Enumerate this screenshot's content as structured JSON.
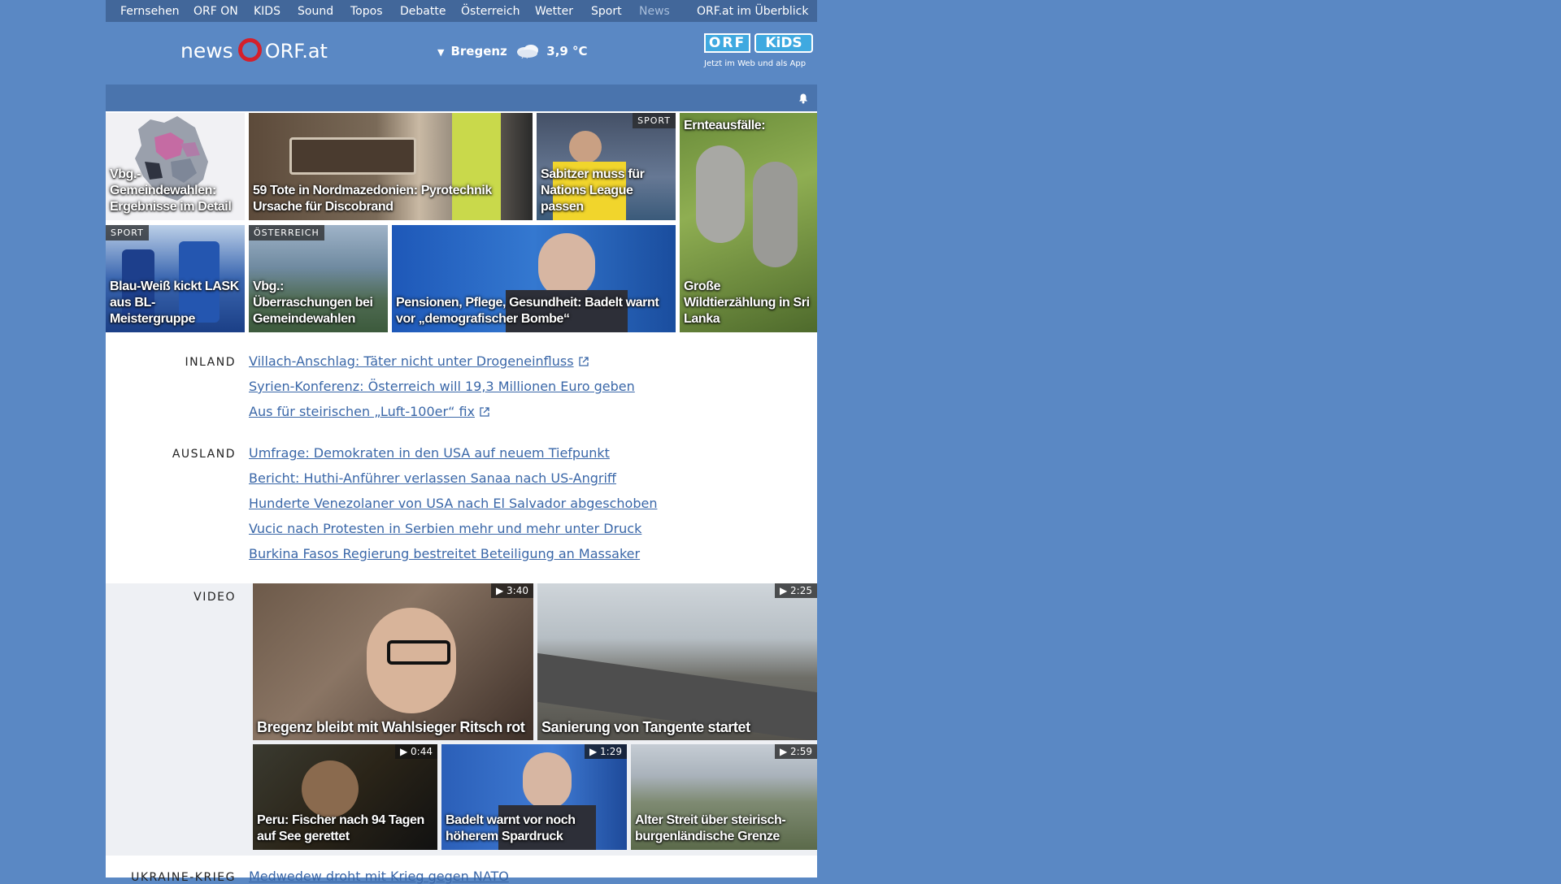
{
  "topnav": {
    "items": [
      "Fernsehen",
      "ORF ON",
      "KIDS",
      "Sound",
      "Topos",
      "Debatte",
      "Österreich",
      "Wetter",
      "Sport",
      "News",
      "ORF.at im Überblick"
    ],
    "current": "News"
  },
  "header": {
    "logo_prefix": "news",
    "logo_suffix": "ORF.at",
    "weather_location": "Bregenz",
    "weather_temp": "3,9 °C",
    "weather_icon": "cloud-rain-icon",
    "kids_orf": "ORF",
    "kids_label": "KiDS",
    "kids_tagline": "Jetzt im Web und als App"
  },
  "colors": {
    "background": "#5a88c4",
    "nav": "#42679a",
    "link": "#3a67a8",
    "orf_red": "#d4202c"
  },
  "tiles": [
    {
      "title": "Vbg.-Gemeindewahlen: Ergebnisse im Detail"
    },
    {
      "title": "59 Tote in Nordmazedonien: Pyrotechnik Ursache für Discobrand"
    },
    {
      "title": "Sabitzer muss für Nations League passen",
      "category": "SPORT"
    },
    {
      "title": "Ernteausfälle: Große Wildtierzählung in Sri Lanka",
      "title_top": "Ernteausfälle:",
      "title_bottom": "Große Wildtierzählung in Sri Lanka"
    },
    {
      "title": "Blau-Weiß kickt LASK aus BL-Meistergruppe",
      "category": "SPORT"
    },
    {
      "title": "Vbg.: Überraschungen bei Gemeindewahlen",
      "category": "ÖSTERREICH"
    },
    {
      "title": "Pensionen, Pflege, Gesundheit: Badelt warnt vor „demografischer Bombe“"
    }
  ],
  "inland": {
    "label": "INLAND",
    "links": [
      "Villach-Anschlag: Täter nicht unter Drogeneinfluss",
      "Syrien-Konferenz: Österreich will 19,3 Millionen Euro geben",
      "Aus für steirischen „Luft-100er“ fix"
    ]
  },
  "ausland": {
    "label": "AUSLAND",
    "links": [
      "Umfrage: Demokraten in den USA auf neuem Tiefpunkt",
      "Bericht: Huthi-Anführer verlassen Sanaa nach US-Angriff",
      "Hunderte Venezolaner von USA nach El Salvador abgeschoben",
      "Vucic nach Protesten in Serbien mehr und mehr unter Druck",
      "Burkina Fasos Regierung bestreitet Beteiligung an Massaker"
    ]
  },
  "video": {
    "label": "VIDEO",
    "items": [
      {
        "title": "Bregenz bleibt mit Wahlsieger Ritsch rot",
        "duration": "3:40"
      },
      {
        "title": "Sanierung von Tangente startet",
        "duration": "2:25"
      },
      {
        "title": "Peru: Fischer nach 94 Tagen auf See gerettet",
        "duration": "0:44"
      },
      {
        "title": "Badelt warnt vor noch höherem Spardruck",
        "duration": "1:29"
      },
      {
        "title": "Alter Streit über steirisch-burgenländische Grenze",
        "duration": "2:59"
      }
    ]
  },
  "ukraine": {
    "label": "UKRAINE-KRIEG",
    "links": [
      "Medwedew droht mit Krieg gegen NATO"
    ]
  }
}
